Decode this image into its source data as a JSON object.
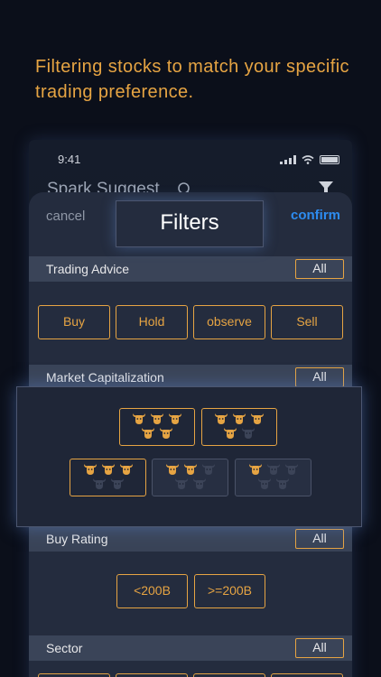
{
  "headline": "Filtering stocks to match your specific trading preference.",
  "status": {
    "time": "9:41"
  },
  "app": {
    "title": "Spark Suggest"
  },
  "sheet": {
    "cancel_label": "cancel",
    "title": "Filters",
    "confirm_label": "confirm"
  },
  "sections": {
    "trading_advice": {
      "label": "Trading Advice",
      "all": "All",
      "options": [
        "Buy",
        "Hold",
        "observe",
        "Sell"
      ]
    },
    "market_cap": {
      "label": "Market Capitalization",
      "all": "All"
    },
    "buy_rating": {
      "label": "Buy Rating",
      "all": "All",
      "options": [
        "<200B",
        ">=200B"
      ]
    },
    "sector": {
      "label": "Sector",
      "all": "All"
    }
  },
  "market_cap_options": [
    {
      "filled": 5,
      "total": 5
    },
    {
      "filled": 4,
      "total": 5
    },
    {
      "filled": 3,
      "total": 5
    },
    {
      "filled": 2,
      "total": 5
    },
    {
      "filled": 1,
      "total": 5
    }
  ],
  "colors": {
    "accent": "#e6a443",
    "confirm": "#2d8cf0",
    "background": "#0b0f1a",
    "sheet": "#242c3e",
    "section_bar": "#3a4458"
  },
  "icons": [
    "search-icon",
    "filter-icon",
    "signal-icon",
    "wifi-icon",
    "battery-icon",
    "bull-icon"
  ]
}
